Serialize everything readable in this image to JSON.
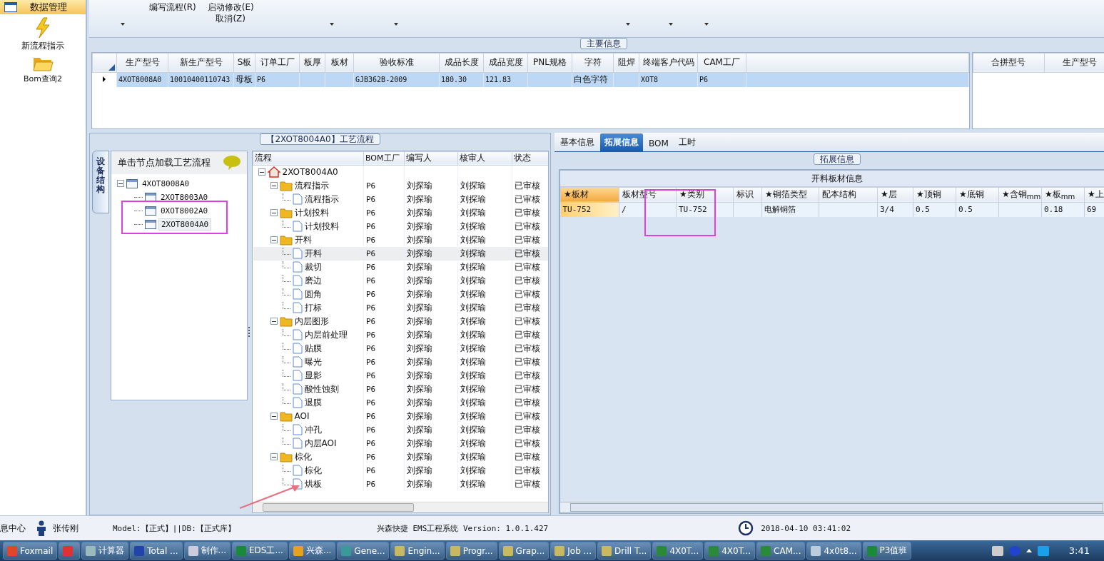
{
  "nav": {
    "header": "数据管理",
    "items": [
      {
        "label": "新流程指示",
        "kind": "lightning"
      },
      {
        "label": "Bom查询2",
        "kind": "folder"
      }
    ]
  },
  "ribbon": {
    "buttons": [
      {
        "label": "编写流程(R)"
      },
      {
        "label": "启动修改(E)"
      },
      {
        "label": "取消(Z)"
      }
    ]
  },
  "main_info": {
    "title": "主要信息",
    "columns": [
      "生产型号",
      "新生产型号",
      "S板",
      "订单工厂",
      "板厚",
      "板材",
      "验收标准",
      "成品长度",
      "成品宽度",
      "PNL规格",
      "字符",
      "阻焊",
      "终端客户代码",
      "CAM工厂"
    ],
    "rows": [
      {
        "selected": true,
        "cells": [
          "4XOT8008A0",
          "10010400110743",
          "母板",
          "P6",
          "",
          "",
          "GJB362B-2009",
          "180.30",
          "121.83",
          "",
          "白色字符",
          "",
          "XOT8",
          "P6"
        ]
      }
    ],
    "side_columns": [
      "合拼型号",
      "生产型号"
    ]
  },
  "flow": {
    "title": "【2XOT8004A0】工艺流程",
    "side_tab": "设备结构",
    "device_header": "单击节点加载工艺流程",
    "devices": [
      {
        "label": "4XOT8008A0",
        "expanded": true,
        "selected": false,
        "children": [
          {
            "label": "2XOT8003A0",
            "selected": false
          },
          {
            "label": "0XOT8002A0",
            "selected": false
          },
          {
            "label": "2XOT8004A0",
            "selected": true
          }
        ]
      }
    ],
    "columns": [
      "流程",
      "BOM工厂",
      "编写人",
      "核审人",
      "状态"
    ],
    "tree": [
      {
        "label": "2XOT8004A0",
        "kind": "root",
        "expanded": true,
        "selected": false,
        "children": [
          {
            "label": "流程指示",
            "kind": "folder",
            "expanded": true,
            "selected": false,
            "bom": "P6",
            "writer": "刘探瑜",
            "reviewer": "刘探瑜",
            "status": "已审核",
            "children": [
              {
                "label": "流程指示",
                "kind": "doc",
                "selected": false,
                "bom": "P6",
                "writer": "刘探瑜",
                "reviewer": "刘探瑜",
                "status": "已审核"
              }
            ]
          },
          {
            "label": "计划投料",
            "kind": "folder",
            "expanded": true,
            "selected": false,
            "bom": "P6",
            "writer": "刘探瑜",
            "reviewer": "刘探瑜",
            "status": "已审核",
            "children": [
              {
                "label": "计划投料",
                "kind": "doc",
                "selected": false,
                "bom": "P6",
                "writer": "刘探瑜",
                "reviewer": "刘探瑜",
                "status": "已审核"
              }
            ]
          },
          {
            "label": "开料",
            "kind": "folder",
            "expanded": true,
            "selected": false,
            "bom": "P6",
            "writer": "刘探瑜",
            "reviewer": "刘探瑜",
            "status": "已审核",
            "children": [
              {
                "label": "开料",
                "kind": "doc",
                "selected": true,
                "bom": "P6",
                "writer": "刘探瑜",
                "reviewer": "刘探瑜",
                "status": "已审核"
              },
              {
                "label": "裁切",
                "kind": "doc",
                "selected": false,
                "bom": "P6",
                "writer": "刘探瑜",
                "reviewer": "刘探瑜",
                "status": "已审核"
              },
              {
                "label": "磨边",
                "kind": "doc",
                "selected": false,
                "bom": "P6",
                "writer": "刘探瑜",
                "reviewer": "刘探瑜",
                "status": "已审核"
              },
              {
                "label": "圆角",
                "kind": "doc",
                "selected": false,
                "bom": "P6",
                "writer": "刘探瑜",
                "reviewer": "刘探瑜",
                "status": "已审核"
              },
              {
                "label": "打标",
                "kind": "doc",
                "selected": false,
                "bom": "P6",
                "writer": "刘探瑜",
                "reviewer": "刘探瑜",
                "status": "已审核"
              }
            ]
          },
          {
            "label": "内层图形",
            "kind": "folder",
            "expanded": true,
            "selected": false,
            "bom": "P6",
            "writer": "刘探瑜",
            "reviewer": "刘探瑜",
            "status": "已审核",
            "children": [
              {
                "label": "内层前处理",
                "kind": "doc",
                "selected": false,
                "bom": "P6",
                "writer": "刘探瑜",
                "reviewer": "刘探瑜",
                "status": "已审核"
              },
              {
                "label": "贴膜",
                "kind": "doc",
                "selected": false,
                "bom": "P6",
                "writer": "刘探瑜",
                "reviewer": "刘探瑜",
                "status": "已审核"
              },
              {
                "label": "曝光",
                "kind": "doc",
                "selected": false,
                "bom": "P6",
                "writer": "刘探瑜",
                "reviewer": "刘探瑜",
                "status": "已审核"
              },
              {
                "label": "显影",
                "kind": "doc",
                "selected": false,
                "bom": "P6",
                "writer": "刘探瑜",
                "reviewer": "刘探瑜",
                "status": "已审核"
              },
              {
                "label": "酸性蚀刻",
                "kind": "doc",
                "selected": false,
                "bom": "P6",
                "writer": "刘探瑜",
                "reviewer": "刘探瑜",
                "status": "已审核"
              },
              {
                "label": "退膜",
                "kind": "doc",
                "selected": false,
                "bom": "P6",
                "writer": "刘探瑜",
                "reviewer": "刘探瑜",
                "status": "已审核"
              }
            ]
          },
          {
            "label": "AOI",
            "kind": "folder",
            "expanded": true,
            "selected": false,
            "bom": "P6",
            "writer": "刘探瑜",
            "reviewer": "刘探瑜",
            "status": "已审核",
            "children": [
              {
                "label": "冲孔",
                "kind": "doc",
                "selected": false,
                "bom": "P6",
                "writer": "刘探瑜",
                "reviewer": "刘探瑜",
                "status": "已审核"
              },
              {
                "label": "内层AOI",
                "kind": "doc",
                "selected": false,
                "bom": "P6",
                "writer": "刘探瑜",
                "reviewer": "刘探瑜",
                "status": "已审核"
              }
            ]
          },
          {
            "label": "棕化",
            "kind": "folder",
            "expanded": true,
            "selected": false,
            "bom": "P6",
            "writer": "刘探瑜",
            "reviewer": "刘探瑜",
            "status": "已审核",
            "children": [
              {
                "label": "棕化",
                "kind": "doc",
                "selected": false,
                "bom": "P6",
                "writer": "刘探瑜",
                "reviewer": "刘探瑜",
                "status": "已审核"
              },
              {
                "label": "烘板",
                "kind": "doc",
                "selected": false,
                "bom": "P6",
                "writer": "刘探瑜",
                "reviewer": "刘探瑜",
                "status": "已审核"
              }
            ]
          }
        ]
      }
    ]
  },
  "ext": {
    "tabs": [
      {
        "label": "基本信息",
        "selected": false
      },
      {
        "label": "拓展信息",
        "selected": true
      },
      {
        "label": "BOM",
        "selected": false
      },
      {
        "label": "工时",
        "selected": false
      }
    ],
    "group_title": "拓展信息",
    "grid_title": "开料板材信息",
    "columns": [
      "★板材",
      "板材型号",
      "★类别",
      "标识",
      "★铜箔类型",
      "配本结构",
      "★层",
      "★顶铜",
      "★底铜",
      "★含铜$_{mm}$",
      "★板$_{mm}$",
      "★上"
    ],
    "rows": [
      {
        "cells": [
          "TU-752",
          "/",
          "TU-752",
          "",
          "电解铜箔",
          "",
          "3/4",
          "0.5",
          "0.5",
          "",
          "0.18",
          "69"
        ]
      }
    ]
  },
  "status_bar": {
    "module": "息中心",
    "user": "张传刚",
    "model": "Model:【正式】||DB:【正式库】",
    "system": "兴森快捷 EMS工程系统 Version: 1.0.1.427",
    "datetime": "2018-04-10 03:41:02"
  },
  "taskbar": {
    "items": [
      {
        "label": "Foxmail",
        "kind": "foxmail"
      },
      {
        "kind": "app"
      },
      {
        "label": "计算器",
        "kind": "calc"
      },
      {
        "label": "Total ...",
        "kind": "disk"
      },
      {
        "label": "制作...",
        "kind": "list"
      },
      {
        "label": "EDS工...",
        "kind": "eds"
      },
      {
        "label": "兴森...",
        "kind": "star"
      },
      {
        "label": "Gene...",
        "kind": "gene"
      },
      {
        "label": "Engin...",
        "kind": "xwin"
      },
      {
        "label": "Progr...",
        "kind": "xwin"
      },
      {
        "label": "Grap...",
        "kind": "xwin"
      },
      {
        "label": "Job ...",
        "kind": "xwin"
      },
      {
        "label": "Drill T...",
        "kind": "xwin"
      },
      {
        "label": "4X0T...",
        "kind": "excel"
      },
      {
        "label": "4X0T...",
        "kind": "excel"
      },
      {
        "label": "CAM...",
        "kind": "excel"
      },
      {
        "label": "4x0t8...",
        "kind": "note"
      },
      {
        "label": "P3值班",
        "kind": "eds"
      }
    ],
    "time": "3:41"
  }
}
